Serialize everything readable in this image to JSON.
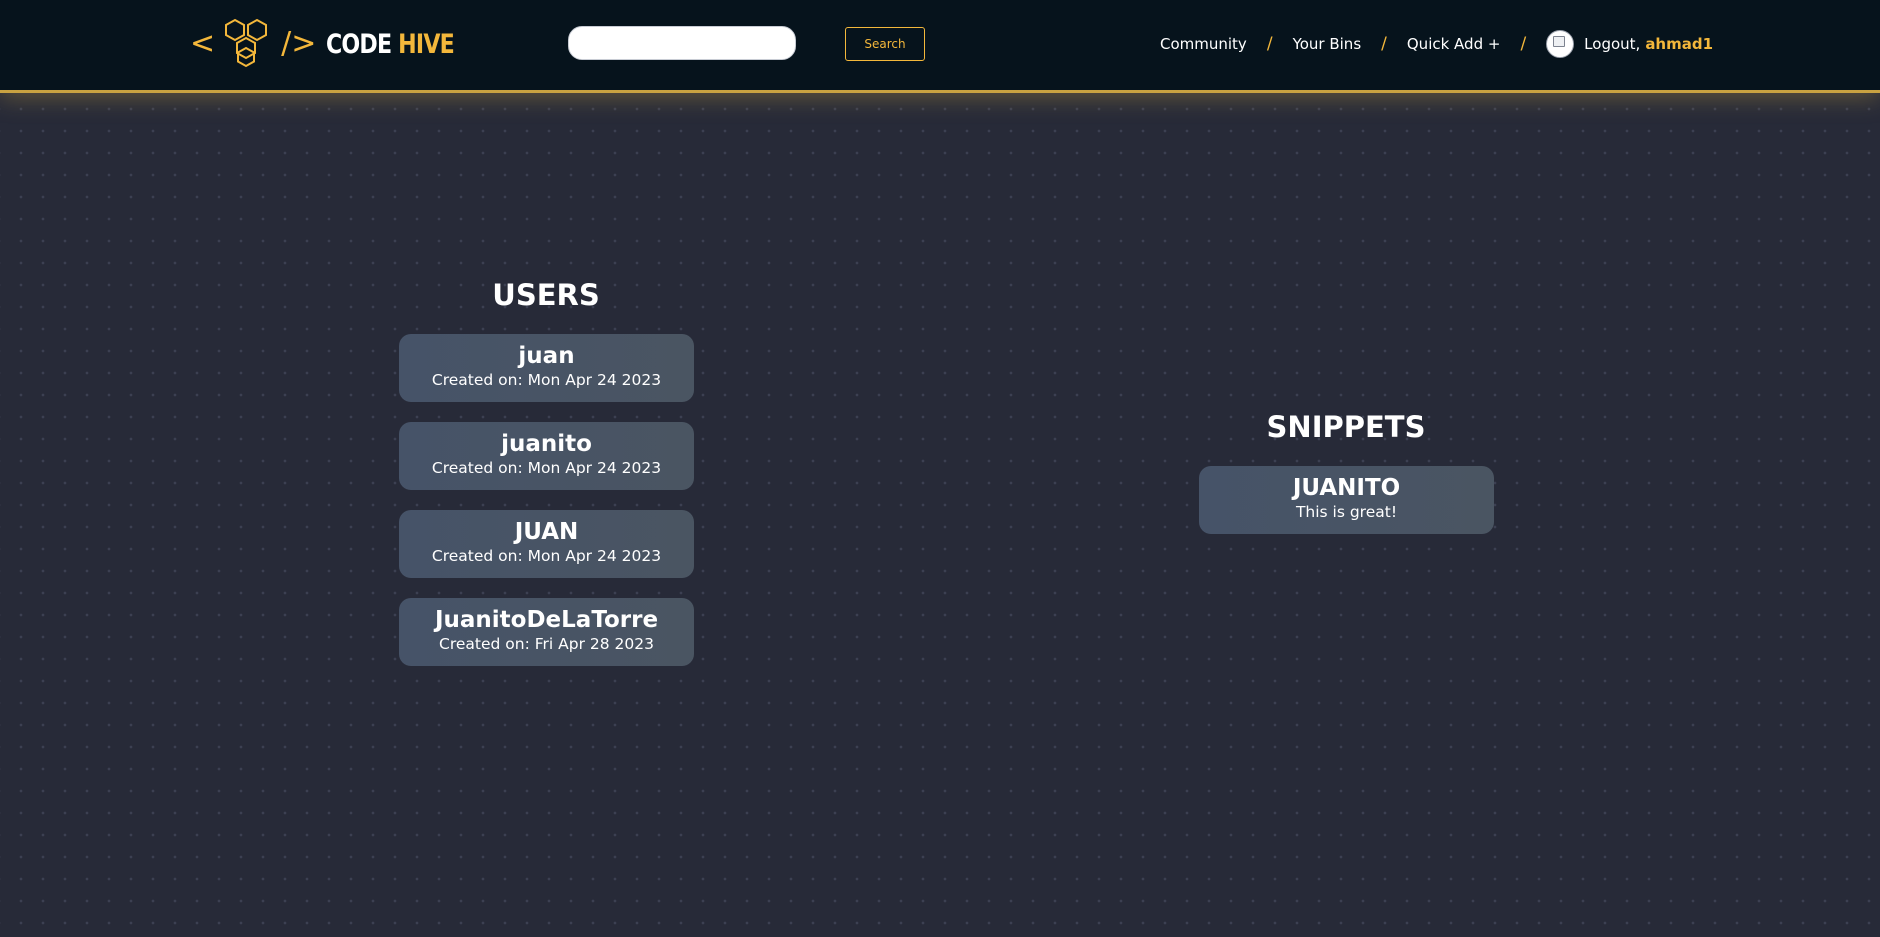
{
  "header": {
    "logo": {
      "open_bracket": "<",
      "close_bracket": "/>",
      "word_code": "CODE",
      "word_hive": "HIVE",
      "icon": "honeycomb-icon"
    },
    "search": {
      "value": "",
      "placeholder": "",
      "button_label": "Search"
    },
    "nav": {
      "community": "Community",
      "your_bins": "Your Bins",
      "quick_add": "Quick Add +",
      "separator": "/",
      "logout_label": "Logout,",
      "username": "ahmad1",
      "avatar_icon": "broken-image-avatar-icon"
    }
  },
  "users": {
    "title": "USERS",
    "items": [
      {
        "name": "juan",
        "created": "Created on: Mon Apr 24 2023"
      },
      {
        "name": "juanito",
        "created": "Created on: Mon Apr 24 2023"
      },
      {
        "name": "JUAN",
        "created": "Created on: Mon Apr 24 2023"
      },
      {
        "name": "JuanitoDeLaTorre",
        "created": "Created on: Fri Apr 28 2023"
      }
    ]
  },
  "snippets": {
    "title": "SNIPPETS",
    "items": [
      {
        "name": "JUANITO",
        "description": "This is great!"
      }
    ]
  },
  "colors": {
    "accent": "#f3b73b",
    "navbar_bg": "#06131c",
    "page_bg": "#272a38",
    "card_bg": "#465368"
  }
}
